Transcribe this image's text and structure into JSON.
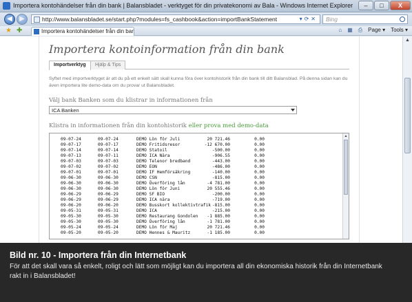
{
  "window": {
    "title": "Importera kontohändelser från din bank | Balansbladet - verktyget för din privatekonomi av Bala - Windows Internet Explorer",
    "buttons": [
      "–",
      "□",
      "X"
    ]
  },
  "address_bar": {
    "url": "http://www.balansbladet.se/start.php?modules=fs_cashbook&action=importBankStatement",
    "search_placeholder": "Bing"
  },
  "tab": {
    "label": "Importera kontohändelser från din bank | Balansb..."
  },
  "commands": {
    "page_label": "Page ▾",
    "tools_label": "Tools ▾"
  },
  "page": {
    "title": "Importera kontoinformation från din bank",
    "tabs": [
      "Importverktyg",
      "Hjälp & Tips"
    ],
    "intro": "Syftet med importverktyget är att du på ett enkelt sätt skall kunna föra över kontohistorik från din bank till ditt Balansblad. På denna sidan kan du även importera lite demo-data om du provar ut Balansbladet.",
    "select_label": "Välj bank Banken som du klistrar in informationen från",
    "selected_bank": "ICA Banken",
    "paste_label": "Klistra in informationen från din kontohistorik",
    "demo_link": "eller prova med demo-data"
  },
  "transactions": [
    [
      "09-07-24",
      "09-07-24",
      "DEMO Lön för Juli",
      "20 721.46",
      "0.00"
    ],
    [
      "09-07-17",
      "09-07-17",
      "DEMO Fritidsresor",
      "-12 670.00",
      "0.00"
    ],
    [
      "09-07-14",
      "09-07-14",
      "DEMO Statoil",
      "-500.00",
      "0.00"
    ],
    [
      "09-07-13",
      "09-07-11",
      "DEMO ICA Nära",
      "-906.55",
      "0.00"
    ],
    [
      "09-07-03",
      "09-07-03",
      "DEMO Telenor bredband",
      "-443.00",
      "0.00"
    ],
    [
      "09-07-02",
      "09-07-02",
      "DEMO EON",
      "-486.00",
      "0.00"
    ],
    [
      "09-07-01",
      "09-07-01",
      "DEMO IF Hemförsäkring",
      "-140.00",
      "0.00"
    ],
    [
      "09-06-30",
      "09-06-30",
      "DEMO CSN",
      "-815.00",
      "0.00"
    ],
    [
      "09-06-30",
      "09-06-30",
      "DEMO Överföring lån",
      "-4 781.00",
      "0.00"
    ],
    [
      "09-06-30",
      "09-06-30",
      "DEMO Lön för Juni",
      "20 555.46",
      "0.00"
    ],
    [
      "09-06-29",
      "09-06-29",
      "DEMO SF BIO",
      "-200.00",
      "0.00"
    ],
    [
      "09-06-29",
      "09-06-29",
      "DEMO ICA nära",
      "-719.00",
      "0.00"
    ],
    [
      "09-06-20",
      "09-06-20",
      "DEMO Busskort kollektivtrafik",
      "-815.00",
      "0.00"
    ],
    [
      "09-05-31",
      "09-05-31",
      "DEMO ICA",
      "-215.00",
      "0.00"
    ],
    [
      "09-05-30",
      "09-05-30",
      "DEMO Restaurang Gondolen",
      "-1 885.00",
      "0.00"
    ],
    [
      "09-05-30",
      "09-05-30",
      "DEMO Överföring lån",
      "-1 781.00",
      "0.00"
    ],
    [
      "09-05-24",
      "09-05-24",
      "DEMO Lön för Maj",
      "20 721.46",
      "0.00"
    ],
    [
      "09-05-20",
      "09-05-20",
      "DEMO Hennes & Mauritz",
      "-1 185.00",
      "0.00"
    ]
  ],
  "caption": {
    "title": "Bild nr. 10 - Importera från din Internetbank",
    "text": "För att det skall vara så enkelt, roligt och lätt som möjligt kan du importera all din ekonomiska historik från din Internetbank rakt in i Balansbladet!"
  },
  "colors": {
    "link_green": "#4a9a3a",
    "caption_bg": "#161616",
    "chrome_blue": "#2b6cc4"
  }
}
